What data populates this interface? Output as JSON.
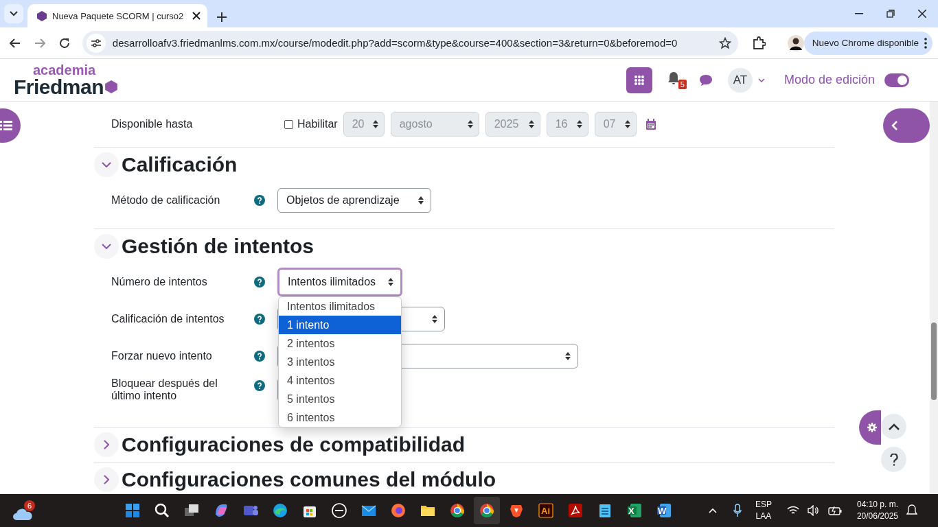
{
  "browser": {
    "tab_title": "Nueva Paquete SCORM | curso2",
    "url": "desarrolloafv3.friedmanlms.com.mx/course/modedit.php?add=scorm&type&course=400&section=3&return=0&beforemod=0",
    "update_button": "Nuevo Chrome disponible"
  },
  "header": {
    "logo_top": "academia",
    "logo_bottom": "Friedman",
    "notifications_count": "5",
    "avatar": "AT",
    "edit_mode_label": "Modo de edición",
    "edit_mode_on": true
  },
  "available_until": {
    "label": "Disponible hasta",
    "enable_label": "Habilitar",
    "enabled": false,
    "day": "20",
    "month": "agosto",
    "year": "2025",
    "hour": "16",
    "minute": "07"
  },
  "sections": [
    {
      "title": "Calificación",
      "expanded": true,
      "fields": [
        {
          "label": "Método de calificación",
          "value": "Objetos de aprendizaje",
          "focused": false
        }
      ]
    },
    {
      "title": "Gestión de intentos",
      "expanded": true,
      "fields": [
        {
          "label": "Número de intentos",
          "value": "Intentos ilimitados",
          "focused": true
        },
        {
          "label": "Calificación de intentos",
          "focused": false
        },
        {
          "label": "Forzar nuevo intento",
          "focused": false
        },
        {
          "label": "Bloquear después del último intento",
          "focused": false
        }
      ]
    },
    {
      "title": "Configuraciones de compatibilidad",
      "expanded": false
    },
    {
      "title": "Configuraciones comunes del módulo",
      "expanded": false
    }
  ],
  "dropdown": {
    "options": [
      {
        "label": "Intentos ilimitados",
        "selected": false
      },
      {
        "label": "1 intento",
        "selected": true
      },
      {
        "label": "2 intentos",
        "selected": false
      },
      {
        "label": "3 intentos",
        "selected": false
      },
      {
        "label": "4 intentos",
        "selected": false
      },
      {
        "label": "5 intentos",
        "selected": false
      },
      {
        "label": "6 intentos",
        "selected": false
      }
    ]
  },
  "taskbar": {
    "weather_badge": "6",
    "apps": [
      {
        "kind": "start"
      },
      {
        "kind": "search"
      },
      {
        "kind": "taskview"
      },
      {
        "kind": "copilot"
      },
      {
        "kind": "teams"
      },
      {
        "kind": "edge"
      },
      {
        "kind": "store"
      },
      {
        "kind": "dell"
      },
      {
        "kind": "mail"
      },
      {
        "kind": "firefox"
      },
      {
        "kind": "folder"
      },
      {
        "kind": "chrome"
      },
      {
        "kind": "chrome",
        "active": true
      },
      {
        "kind": "brave"
      },
      {
        "kind": "illustrator",
        "label": "Ai"
      },
      {
        "kind": "acrobat"
      },
      {
        "kind": "notepad"
      },
      {
        "kind": "excel",
        "label": "X"
      },
      {
        "kind": "word",
        "label": "W"
      }
    ],
    "language": "ESP",
    "layout": "LAA",
    "time": "04:10 p. m.",
    "date": "20/06/2025"
  }
}
